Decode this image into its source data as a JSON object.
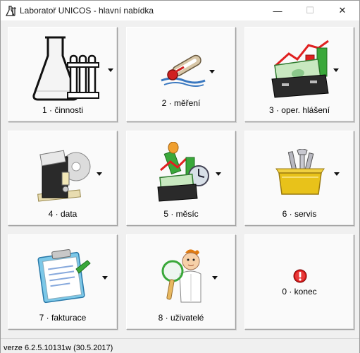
{
  "window": {
    "title": "Laboratoř  UNICOS - hlavní nabídka",
    "controls": {
      "minimize": "—",
      "maximize": "☐",
      "close": "✕"
    }
  },
  "menu": {
    "tiles": [
      {
        "label": "1 · činnosti",
        "icon": "flask-icon",
        "has_dropdown": true
      },
      {
        "label": "2 · měření",
        "icon": "thermometer-icon",
        "has_dropdown": true
      },
      {
        "label": "3 · oper. hlášení",
        "icon": "briefcase-chart-icon",
        "has_dropdown": true
      },
      {
        "label": "4 · data",
        "icon": "data-archive-icon",
        "has_dropdown": true
      },
      {
        "label": "5 · měsíc",
        "icon": "monthly-report-icon",
        "has_dropdown": true
      },
      {
        "label": "6 · servis",
        "icon": "toolbox-icon",
        "has_dropdown": true
      },
      {
        "label": "7 · fakturace",
        "icon": "clipboard-icon",
        "has_dropdown": true
      },
      {
        "label": "8 · uživatelé",
        "icon": "user-magnifier-icon",
        "has_dropdown": true
      },
      {
        "label": "0 · konec",
        "icon": "exit-icon",
        "has_dropdown": false
      }
    ]
  },
  "status": {
    "version": "verze 6.2.5.10131w (30.5.2017)"
  },
  "colors": {
    "accent_green": "#3aa83a",
    "accent_red": "#e02020",
    "folder_yellow": "#e8c21a"
  }
}
